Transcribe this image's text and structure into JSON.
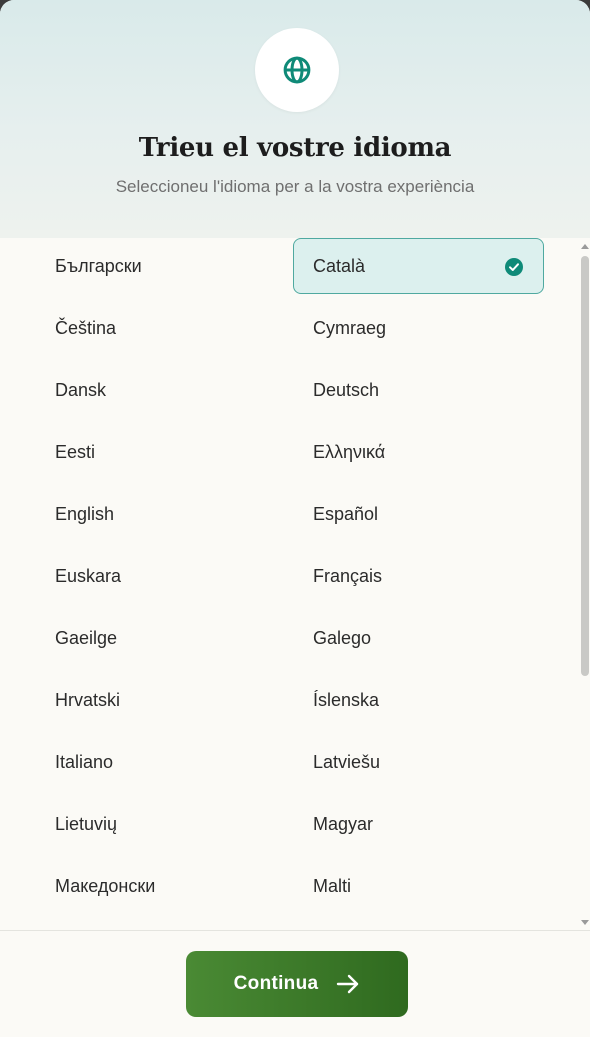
{
  "header": {
    "icon": "globe-icon",
    "title": "Trieu el vostre idioma",
    "subtitle": "Seleccioneu l'idioma per a la vostra experiència"
  },
  "languages": [
    {
      "label": "Български",
      "selected": false
    },
    {
      "label": "Català",
      "selected": true
    },
    {
      "label": "Čeština",
      "selected": false
    },
    {
      "label": "Cymraeg",
      "selected": false
    },
    {
      "label": "Dansk",
      "selected": false
    },
    {
      "label": "Deutsch",
      "selected": false
    },
    {
      "label": "Eesti",
      "selected": false
    },
    {
      "label": "Ελληνικά",
      "selected": false
    },
    {
      "label": "English",
      "selected": false
    },
    {
      "label": "Español",
      "selected": false
    },
    {
      "label": "Euskara",
      "selected": false
    },
    {
      "label": "Français",
      "selected": false
    },
    {
      "label": "Gaeilge",
      "selected": false
    },
    {
      "label": "Galego",
      "selected": false
    },
    {
      "label": "Hrvatski",
      "selected": false
    },
    {
      "label": "Íslenska",
      "selected": false
    },
    {
      "label": "Italiano",
      "selected": false
    },
    {
      "label": "Latviešu",
      "selected": false
    },
    {
      "label": "Lietuvių",
      "selected": false
    },
    {
      "label": "Magyar",
      "selected": false
    },
    {
      "label": "Македонски",
      "selected": false
    },
    {
      "label": "Malti",
      "selected": false
    }
  ],
  "footer": {
    "continue_label": "Continua",
    "continue_icon": "arrow-right-icon"
  },
  "colors": {
    "accent_teal": "#0f8a78",
    "selected_bg": "#dcf0ee",
    "selected_border": "#4fa9a0",
    "button_green": "#3a7a28"
  }
}
